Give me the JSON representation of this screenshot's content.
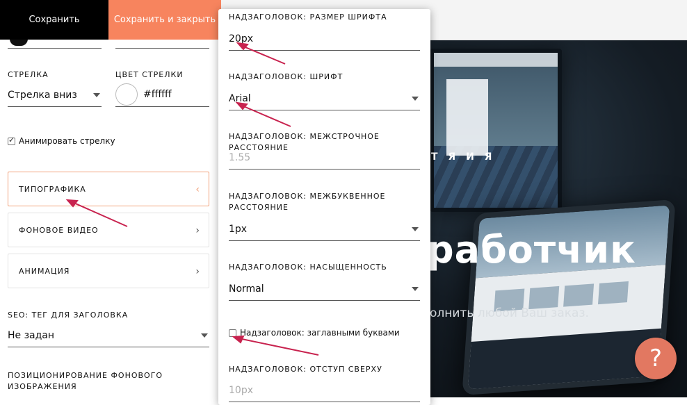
{
  "toolbar": {
    "save_label": "Сохранить",
    "save_close_label": "Сохранить и закрыть"
  },
  "left_panel": {
    "arrow_label": "Стрелка",
    "arrow_value": "Стрелка вниз",
    "arrow_color_label": "Цвет стрелки",
    "arrow_color_value": "#ffffff",
    "animate_arrow_label": "Анимировать стрелку",
    "animate_arrow_checked": true,
    "sections": [
      {
        "label": "ТИПОГРАФИКА",
        "active": true
      },
      {
        "label": "ФОНОВОЕ ВИДЕО",
        "active": false
      },
      {
        "label": "АНИМАЦИЯ",
        "active": false
      }
    ],
    "seo_label": "SEO: тег для заголовка",
    "seo_value": "Не задан",
    "bg_position_label": "Позиционирование фонового изображения"
  },
  "popover": {
    "font_size_label": "Надзаголовок: размер шрифта",
    "font_size_value": "20px",
    "font_label": "Надзаголовок: шрифт",
    "font_value": "Arial",
    "line_height_label": "Надзаголовок: межстрочное расстояние",
    "line_height_placeholder": "1.55",
    "letter_spacing_label": "Надзаголовок: межбуквенное расстояние",
    "letter_spacing_value": "1px",
    "weight_label": "Надзаголовок: насыщенность",
    "weight_value": "Normal",
    "uppercase_label": "Надзаголовок: заглавными буквами",
    "uppercase_checked": false,
    "margin_top_label": "Надзаголовок: отступ сверху",
    "margin_top_placeholder": "10px"
  },
  "preview": {
    "kicker_partial": "Т Я И Я",
    "title_partial": "работчик",
    "subtitle_partial": "олнить любой Ваш заказ."
  },
  "help_button_label": "?",
  "colors": {
    "accent": "#f7845e",
    "annotation_arrow": "#c8234f",
    "help_button": "#e27861"
  }
}
